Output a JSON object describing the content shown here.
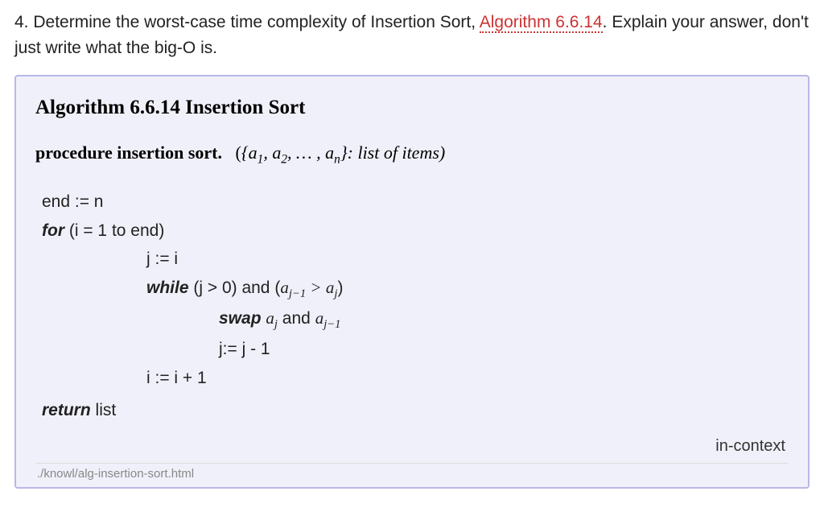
{
  "question": {
    "number": "4.",
    "text_before_link": " Determine the worst-case time complexity of Insertion Sort, ",
    "link_text": "Algorithm 6.6.14",
    "text_after_link": ". Explain your answer, don't just write what the big-O is."
  },
  "algorithm": {
    "title": "Algorithm 6.6.14  Insertion Sort",
    "procedure_label": "procedure insertion sort.",
    "procedure_signature_prefix": "({",
    "procedure_items": "a",
    "procedure_list_desc": ": list of items)",
    "code": {
      "line1": "end := n",
      "line2_kw": "for",
      "line2_rest": " (i = 1 to end)",
      "line3": "j := i",
      "line4_kw": "while",
      "line4_rest_a": " (j > 0) and (",
      "line4_rest_b": ")",
      "line5_kw": "swap",
      "line5_rest_a": " ",
      "line5_and": " and ",
      "line6": "j:= j - 1",
      "line7": "i := i + 1",
      "line8_kw": "return",
      "line8_rest": " list"
    },
    "in_context": "in-context",
    "footer_path": "./knowl/alg-insertion-sort.html"
  }
}
